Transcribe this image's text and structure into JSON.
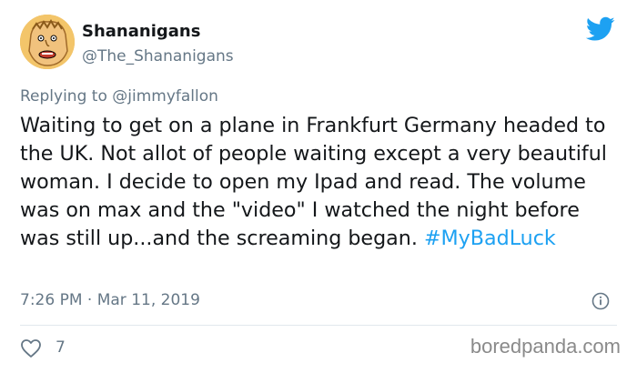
{
  "author": {
    "name": "Shananigans",
    "handle": "@The_Shananigans",
    "avatar_icon": "cartoon-avatar"
  },
  "reply": {
    "prefix": "Replying to ",
    "mention": "@jimmyfallon"
  },
  "tweet": {
    "text": "Waiting to get on a plane in Frankfurt Germany headed to the UK. Not allot of people waiting except a very beautiful woman. I decide to open my Ipad and read. The volume was on max and the \"video\" I watched the night before was still up...and the screaming began. ",
    "hashtag": "#MyBadLuck"
  },
  "meta": {
    "timestamp": "7:26 PM · Mar 11, 2019"
  },
  "actions": {
    "like_count": "7"
  },
  "watermark": {
    "text": "boredpanda.com"
  },
  "colors": {
    "twitter_blue": "#1da1f2",
    "secondary_text": "#657786",
    "divider": "#e1e8ed"
  }
}
